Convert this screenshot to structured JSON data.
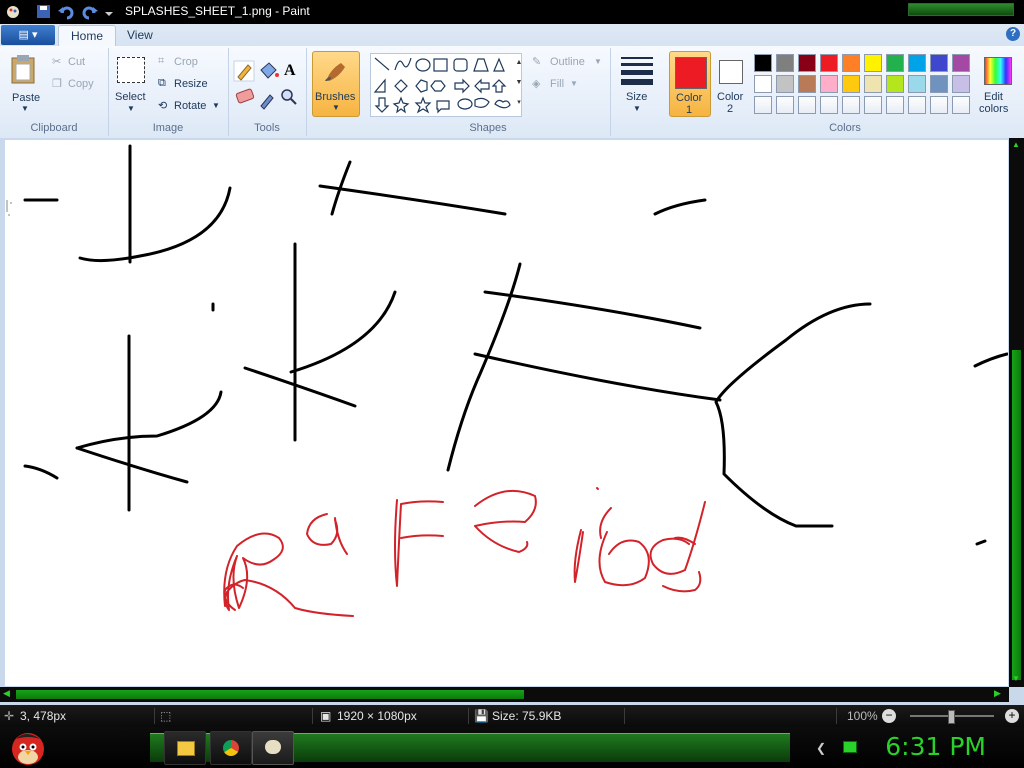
{
  "window": {
    "title": "SPLASHES_SHEET_1.png - Paint"
  },
  "tabs": {
    "home": "Home",
    "view": "View",
    "help": "?"
  },
  "ribbon": {
    "clipboard": {
      "paste": "Paste",
      "cut": "Cut",
      "copy": "Copy",
      "label": "Clipboard"
    },
    "image": {
      "select": "Select",
      "crop": "Crop",
      "resize": "Resize",
      "rotate": "Rotate",
      "label": "Image"
    },
    "tools": {
      "text_tool": "A",
      "label": "Tools"
    },
    "brushes": {
      "label": "Brushes"
    },
    "shapes": {
      "outline": "Outline",
      "fill": "Fill",
      "label": "Shapes"
    },
    "size": {
      "label": "Size"
    },
    "colors": {
      "color1": "Color\n1",
      "color1_a": "Color",
      "color1_b": "1",
      "color2_a": "Color",
      "color2_b": "2",
      "edit_a": "Edit",
      "edit_b": "colors",
      "label": "Colors",
      "color1_value": "#ed1c24",
      "color2_value": "#ffffff",
      "palette_row1": [
        "#000000",
        "#7f7f7f",
        "#880015",
        "#ed1c24",
        "#ff7f27",
        "#fff200",
        "#22b14c",
        "#00a2e8",
        "#3f48cc",
        "#a349a4"
      ],
      "palette_row2": [
        "#ffffff",
        "#c3c3c3",
        "#b97a57",
        "#ffaec9",
        "#ffc90e",
        "#efe4b0",
        "#b5e61d",
        "#99d9ea",
        "#7092be",
        "#c8bfe7"
      ],
      "palette_row3": [
        "#ffffff",
        "#ffffff",
        "#ffffff",
        "#ffffff",
        "#ffffff",
        "#ffffff",
        "#ffffff",
        "#ffffff",
        "#ffffff",
        "#ffffff"
      ]
    }
  },
  "status": {
    "cursor": "3, 478px",
    "dimensions": "1920 × 1080px",
    "size": "Size: 75.9KB",
    "zoom": "100%"
  },
  "taskbar": {
    "clock": "6:31 PM"
  }
}
